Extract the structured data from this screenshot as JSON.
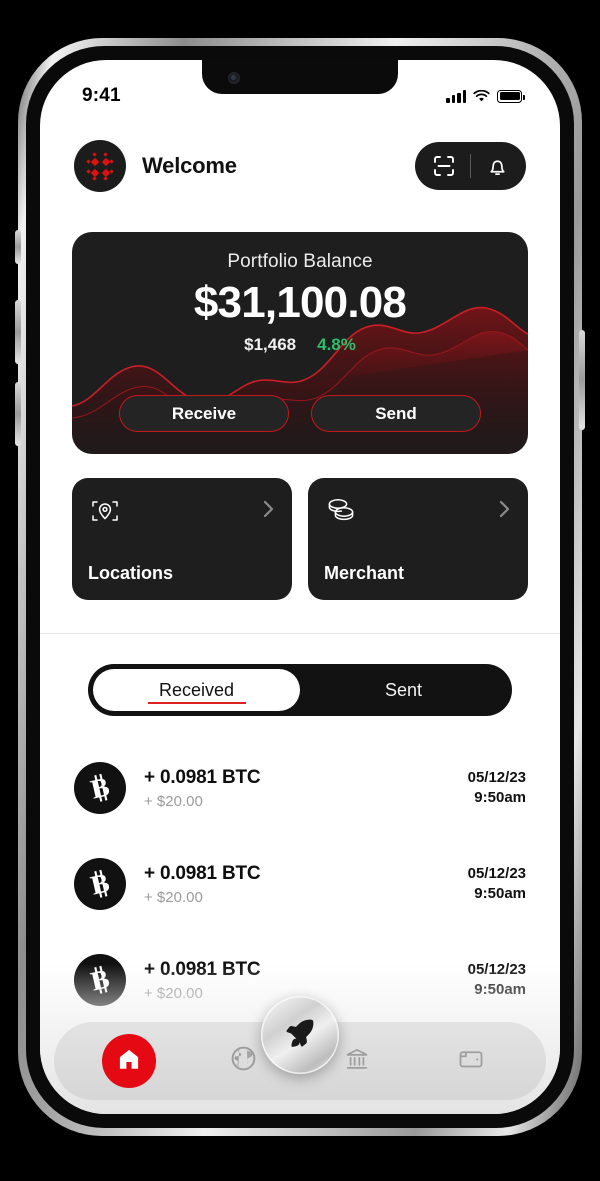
{
  "status_bar": {
    "time": "9:41",
    "signal_icon": "cellular-signal-icon",
    "wifi_icon": "wifi-icon",
    "battery_icon": "battery-icon"
  },
  "header": {
    "avatar_name": "user-avatar",
    "greeting": "Welcome",
    "scan_icon": "scan-icon",
    "bell_icon": "notification-bell-icon"
  },
  "balance_card": {
    "title": "Portfolio Balance",
    "amount": "$31,100.08",
    "change_amount": "$1,468",
    "change_percent": "4.8%",
    "change_color": "#2ebd6b",
    "accent_color": "#c4191c",
    "receive_label": "Receive",
    "send_label": "Send"
  },
  "shortcuts": [
    {
      "label": "Locations",
      "icon": "map-pin-scan-icon",
      "chevron": "chevron-right-icon"
    },
    {
      "label": "Merchant",
      "icon": "coins-stack-icon",
      "chevron": "chevron-right-icon"
    }
  ],
  "tabs": [
    {
      "label": "Received",
      "active": true
    },
    {
      "label": "Sent",
      "active": false
    }
  ],
  "transactions": [
    {
      "icon": "bitcoin-icon",
      "amount": "+ 0.0981 BTC",
      "fiat": "+ $20.00",
      "date": "05/12/23",
      "time": "9:50am"
    },
    {
      "icon": "bitcoin-icon",
      "amount": "+ 0.0981 BTC",
      "fiat": "+ $20.00",
      "date": "05/12/23",
      "time": "9:50am"
    },
    {
      "icon": "bitcoin-icon",
      "amount": "+ 0.0981 BTC",
      "fiat": "+ $20.00",
      "date": "05/12/23",
      "time": "9:50am"
    }
  ],
  "bottom_nav": {
    "active_color": "#e50914",
    "items": [
      {
        "icon": "home-icon",
        "active": true
      },
      {
        "icon": "globe-icon",
        "active": false
      },
      {
        "icon": "bank-icon",
        "active": false
      },
      {
        "icon": "wallet-icon",
        "active": false
      }
    ],
    "fab_icon": "rocket-icon"
  }
}
